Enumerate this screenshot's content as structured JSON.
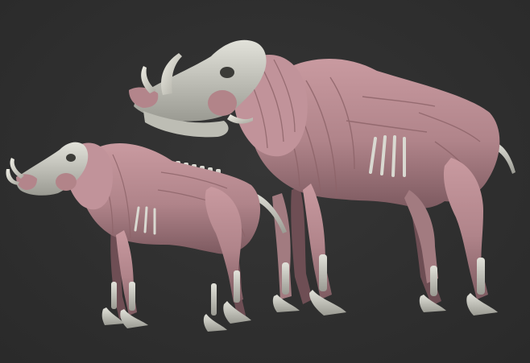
{
  "scene": {
    "description_visible_text": "",
    "background_color": "#2f2f2f",
    "muscle_color": "#b98a8f",
    "muscle_shadow_color": "#7f5a60",
    "bone_color": "#cfcfc7",
    "bone_shadow_color": "#8f8f88"
  },
  "figures": [
    {
      "name": "large-boar-ecorche",
      "facing": "left"
    },
    {
      "name": "small-boar-ecorche",
      "facing": "left"
    }
  ]
}
